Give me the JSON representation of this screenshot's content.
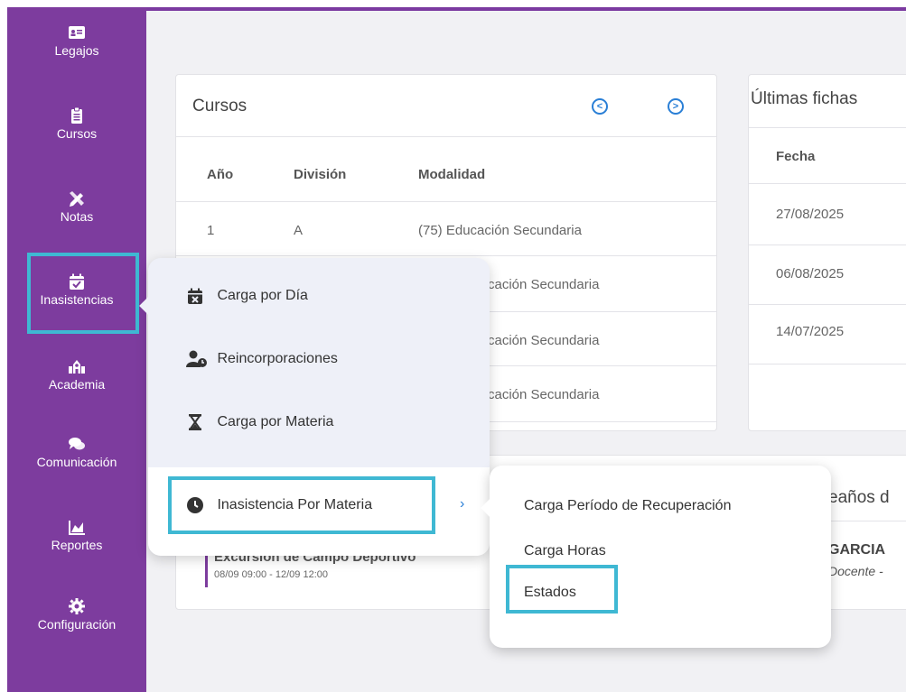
{
  "sidebar": {
    "items": [
      {
        "label": "Legajos",
        "icon": "id-card-icon"
      },
      {
        "label": "Cursos",
        "icon": "clipboard-icon"
      },
      {
        "label": "Notas",
        "icon": "pencil-ruler-icon"
      },
      {
        "label": "Inasistencias",
        "icon": "calendar-check-icon"
      },
      {
        "label": "Academia",
        "icon": "school-icon"
      },
      {
        "label": "Comunicación",
        "icon": "chat-bubbles-icon"
      },
      {
        "label": "Reportes",
        "icon": "area-chart-icon"
      },
      {
        "label": "Configuración",
        "icon": "gear-icon"
      }
    ]
  },
  "cursos": {
    "title": "Cursos",
    "headers": [
      "Año",
      "División",
      "Modalidad"
    ],
    "rows": [
      [
        "1",
        "A",
        "(75) Educación Secundaria"
      ],
      [
        "",
        "",
        "cación Secundaria"
      ],
      [
        "",
        "",
        "cación Secundaria"
      ],
      [
        "",
        "",
        "cación Secundaria"
      ]
    ]
  },
  "fichas": {
    "title": "Últimas fichas",
    "header": "Fecha",
    "dates": [
      "27/08/2025",
      "06/08/2025",
      "14/07/2025"
    ]
  },
  "cumple": {
    "title_fragment": "eaños d",
    "name_fragment": "GARCIA",
    "role_fragment": "Docente -"
  },
  "evento": {
    "title_fragment": "Excursión de Campo Deportivo",
    "date_range": "08/09 09:00 - 12/09 12:00"
  },
  "submenu": {
    "items": [
      {
        "label": "Carga por Día",
        "icon": "calendar-x-icon"
      },
      {
        "label": "Reincorporaciones",
        "icon": "user-clock-icon"
      },
      {
        "label": "Carga por Materia",
        "icon": "hourglass-icon"
      },
      {
        "label": "Inasistencia Por Materia",
        "icon": "clock-icon"
      }
    ],
    "arrow": "›"
  },
  "submenu2": {
    "items": [
      "Carga Período de Recuperación",
      "Carga Horas",
      "Estados"
    ]
  },
  "colors": {
    "sidebar": "#7d3c9e",
    "highlight": "#3fb8d3",
    "accent": "#2a7fd6"
  }
}
